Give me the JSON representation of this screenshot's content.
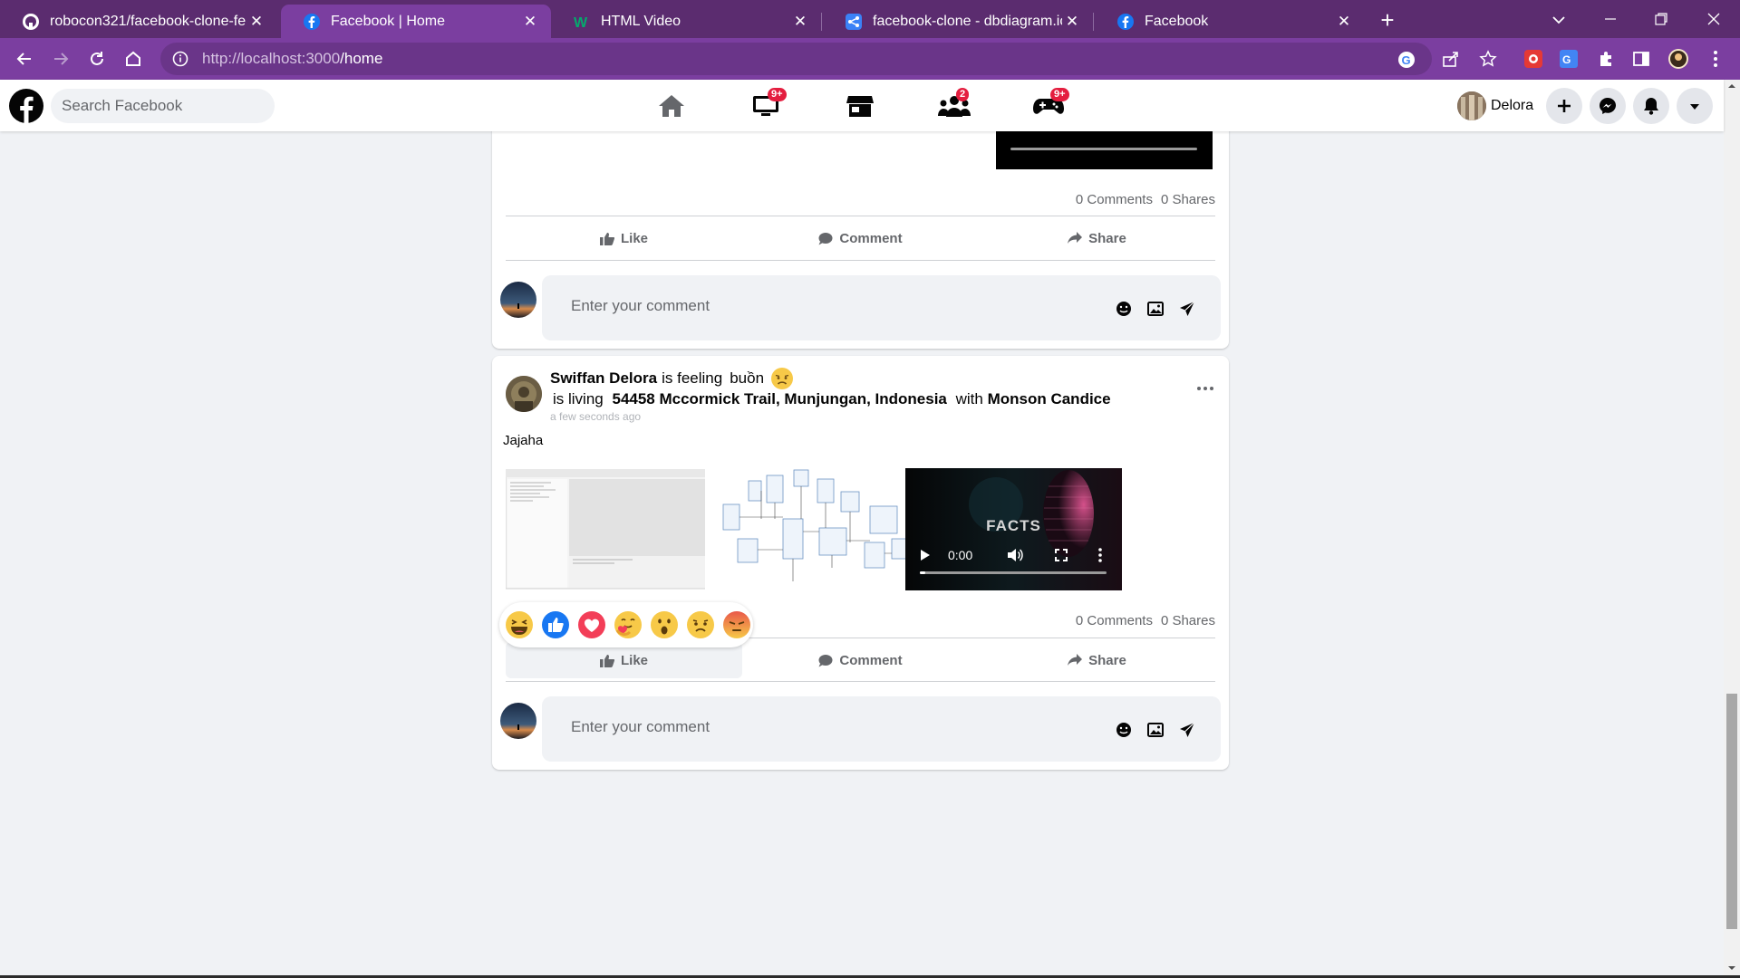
{
  "browser": {
    "tabs": [
      {
        "title": "robocon321/facebook-clone-fe",
        "favicon": "github-icon"
      },
      {
        "title": "Facebook | Home",
        "favicon": "facebook-icon",
        "active": true
      },
      {
        "title": "HTML Video",
        "favicon": "w3schools-icon"
      },
      {
        "title": "facebook-clone - dbdiagram.io",
        "favicon": "dbdiagram-icon"
      },
      {
        "title": "Facebook",
        "favicon": "facebook-icon"
      }
    ],
    "url_host": "http://localhost:3000",
    "url_path": "/home",
    "colors": {
      "tabbar": "#5b2c6f",
      "toolbar": "#7b3ea0"
    }
  },
  "header": {
    "search_placeholder": "Search Facebook",
    "nav": [
      {
        "name": "home-icon",
        "badge": ""
      },
      {
        "name": "watch-icon",
        "badge": "9+"
      },
      {
        "name": "marketplace-icon",
        "badge": ""
      },
      {
        "name": "groups-icon",
        "badge": "2"
      },
      {
        "name": "gaming-icon",
        "badge": "9+"
      }
    ],
    "user_name": "Delora"
  },
  "post1": {
    "comments": "0 Comments",
    "shares": "0 Shares",
    "like_label": "Like",
    "comment_label": "Comment",
    "share_label": "Share",
    "comment_placeholder": "Enter your comment"
  },
  "post2": {
    "author": "Swiffan Delora",
    "feeling_prefix": "is feeling",
    "feeling": "buồn",
    "living_prefix": "is living",
    "location": "54458 Mccormick Trail, Munjungan, Indonesia",
    "with_prefix": "with",
    "tagged": "Monson Candice",
    "timestamp": "a few seconds ago",
    "text": "Jajaha",
    "video_time": "0:00",
    "video_overlay_text": "FACTS",
    "comments": "0 Comments",
    "shares": "0 Shares",
    "like_label": "Like",
    "comment_label": "Comment",
    "share_label": "Share",
    "comment_placeholder": "Enter your comment",
    "reactions": [
      "haha",
      "like",
      "love",
      "care",
      "wow",
      "sad",
      "angry"
    ]
  }
}
